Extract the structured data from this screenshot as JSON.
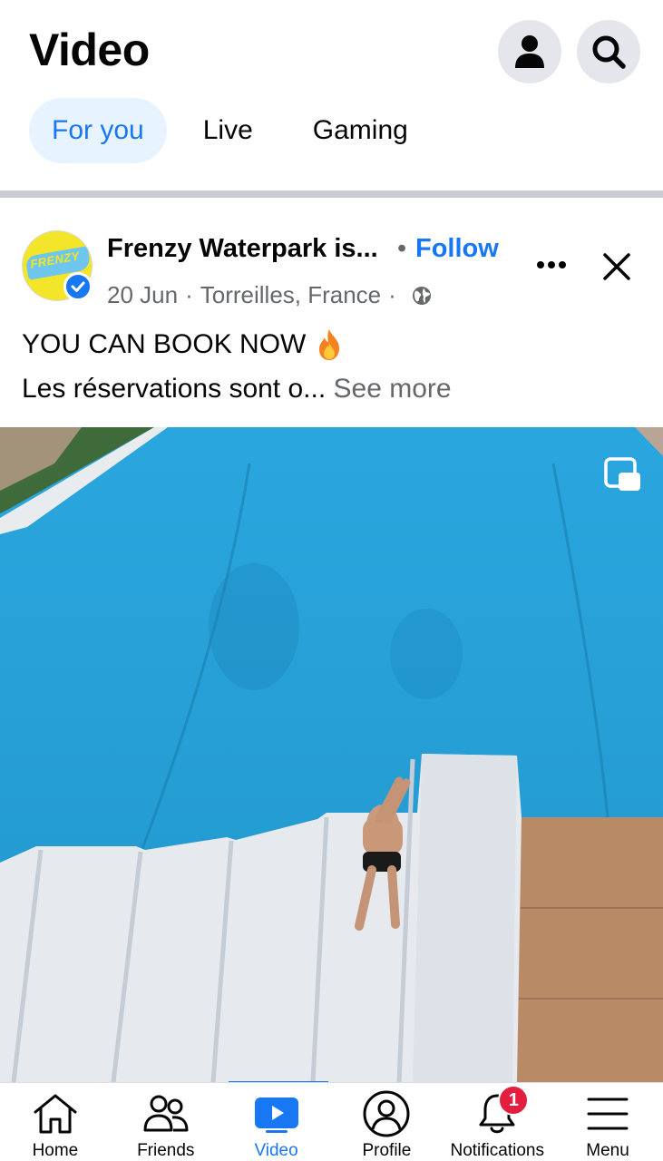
{
  "header": {
    "title": "Video",
    "profile_icon": "person-icon",
    "search_icon": "search-icon"
  },
  "tabs": [
    {
      "label": "For you",
      "active": true
    },
    {
      "label": "Live",
      "active": false
    },
    {
      "label": "Gaming",
      "active": false
    }
  ],
  "post": {
    "page_name": "Frenzy Waterpark is...",
    "follow_dot": "•",
    "follow_label": "Follow",
    "date": "20 Jun",
    "location": "Torreilles, France",
    "meta_sep": "·",
    "avatar_text": "FRENZY",
    "caption_line_1": "YOU CAN BOOK NOW",
    "caption_line_2": "Les réservations sont o...",
    "see_more": "See more"
  },
  "colors": {
    "accent": "#1877f2",
    "pool": "#25a4dc",
    "badge": "#e41e3f"
  },
  "bottom_nav": [
    {
      "label": "Home",
      "icon": "home-icon"
    },
    {
      "label": "Friends",
      "icon": "friends-icon"
    },
    {
      "label": "Video",
      "icon": "video-icon",
      "active": true
    },
    {
      "label": "Profile",
      "icon": "profile-icon"
    },
    {
      "label": "Notifications",
      "icon": "bell-icon",
      "badge": "1"
    },
    {
      "label": "Menu",
      "icon": "menu-icon"
    }
  ]
}
